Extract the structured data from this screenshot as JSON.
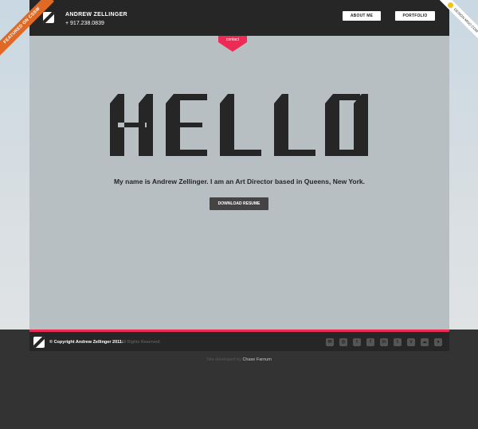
{
  "header": {
    "name": "ANDREW ZELLINGER",
    "phone": "+ 917.238.0839",
    "nav": [
      {
        "label": "ABOUT ME"
      },
      {
        "label": "PORTFOLIO"
      }
    ]
  },
  "contact_tab": {
    "label": "contact",
    "color": "#ee2b55"
  },
  "hero": {
    "headline": "HELLO",
    "intro": "My name is Andrew Zellinger. I am an Art Director based in Queens, New York.",
    "download_label": "DOWNLOAD RESUME"
  },
  "footer": {
    "copyright": "©  Copyright Andrew Zellinger 2011.",
    "rights": "All Rights Reserved.",
    "social_icons": [
      "email-icon",
      "dribbble-icon",
      "twitter-icon",
      "facebook-icon",
      "linkedin-icon",
      "tumblr-icon",
      "vimeo-icon",
      "cloud-icon",
      "location-icon"
    ]
  },
  "credit": {
    "prefix": "Site developed by",
    "author": "Chase Farnum"
  },
  "ribbons": {
    "left": "FEATURED ON CSSW",
    "right": "DESIGN MOO.COM"
  },
  "colors": {
    "accent": "#ee2b55",
    "header_bg": "#262626",
    "panel_bg": "#b8bfc2",
    "ribbon_orange": "#e06a25"
  }
}
